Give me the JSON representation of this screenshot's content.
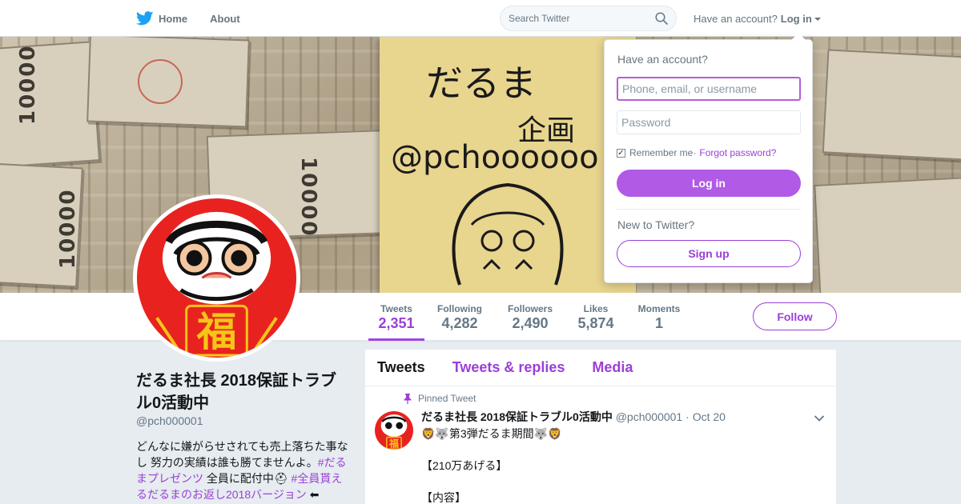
{
  "colors": {
    "accent": "#9b3fd8",
    "twitter_blue": "#1da1f2",
    "background": "#e6ecf0"
  },
  "nav": {
    "home": "Home",
    "about": "About",
    "search_placeholder": "Search Twitter",
    "have_account": "Have an account?",
    "login": "Log in"
  },
  "banner": {
    "note_line1": "だるま",
    "note_line2": "企画",
    "note_line3": "@pchoooooo",
    "bill_number": "10000"
  },
  "stats": [
    {
      "label": "Tweets",
      "value": "2,351"
    },
    {
      "label": "Following",
      "value": "4,282"
    },
    {
      "label": "Followers",
      "value": "2,490"
    },
    {
      "label": "Likes",
      "value": "5,874"
    },
    {
      "label": "Moments",
      "value": "1"
    }
  ],
  "follow_label": "Follow",
  "profile": {
    "name": "だるま社長 2018保証トラブル0活動中",
    "handle": "@pch000001",
    "bio_1": "どんなに嫌がらせされても売上落ちた事なし 努力の実績は誰も勝てませんよ。",
    "bio_tag1": "#だるまプレゼンツ",
    "bio_2": " 全員に配付中",
    "bio_tag2": " #全員貰えるだるまのお返し2018バージョン",
    "bio_3": " ⬅"
  },
  "timeline": {
    "tabs": [
      "Tweets",
      "Tweets & replies",
      "Media"
    ],
    "tweet": {
      "pinned_label": "Pinned Tweet",
      "fullname": "だるま社長 2018保証トラブル0活動中",
      "handle": "@pch000001",
      "separator": " · ",
      "date": "Oct 20",
      "text": "🦁🐺第3弾だるま期間🐺🦁\n\n【210万あげる】\n\n【内容】"
    }
  },
  "login_dropdown": {
    "title": "Have an account?",
    "username_placeholder": "Phone, email, or username",
    "password_placeholder": "Password",
    "remember": "Remember me",
    "separator": " · ",
    "forgot": "Forgot password?",
    "login_button": "Log in",
    "new_to": "New to Twitter?",
    "signup_button": "Sign up"
  }
}
